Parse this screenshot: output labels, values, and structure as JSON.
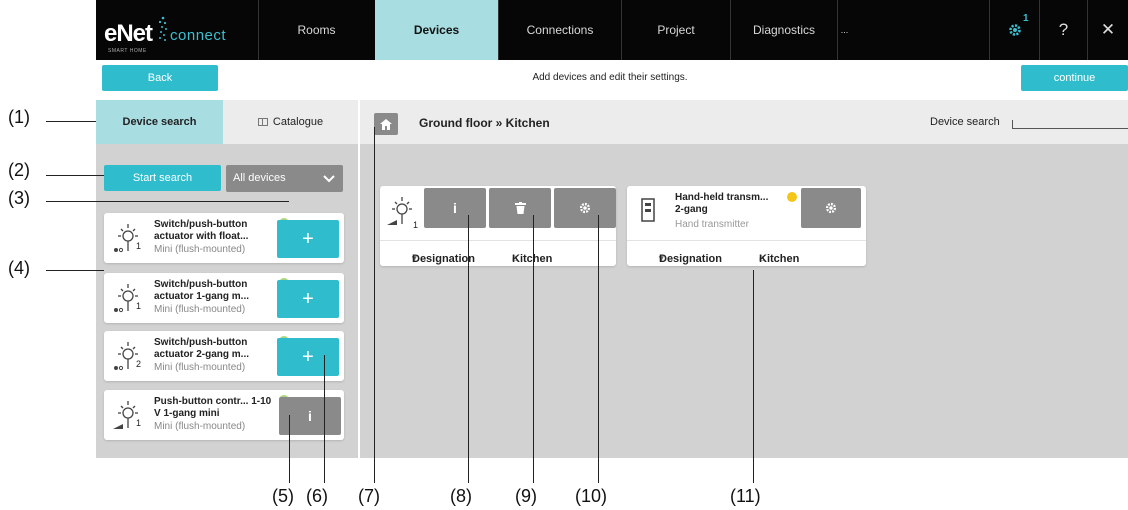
{
  "app": {
    "brand": "eNet",
    "brand_sub": "SMART HOME",
    "product": "connect"
  },
  "nav": {
    "tabs": [
      "Rooms",
      "Devices",
      "Connections",
      "Project",
      "Diagnostics"
    ],
    "active": "Devices",
    "overflow": "...",
    "settings_badge": "1",
    "help": "?",
    "close": "✕"
  },
  "subbar": {
    "back_label": "Back",
    "instruction": "Add devices and edit their settings.",
    "continue_label": "continue"
  },
  "left": {
    "tab_device_search": "Device search",
    "tab_catalogue": "Catalogue",
    "start_search": "Start search",
    "filter_value": "All devices",
    "devices": [
      {
        "name": "Switch/push-button actuator with float...",
        "type": "Mini (flush-mounted)",
        "channel": "1",
        "action": "+"
      },
      {
        "name": "Switch/push-button actuator 1-gang m...",
        "type": "Mini (flush-mounted)",
        "channel": "1",
        "action": "+"
      },
      {
        "name": "Switch/push-button actuator 2-gang m...",
        "type": "Mini (flush-mounted)",
        "channel": "2",
        "action": "+"
      },
      {
        "name": "Push-button contr... 1-10 V 1-gang mini",
        "type": "Mini (flush-mounted)",
        "channel": "1",
        "action": "i"
      }
    ]
  },
  "right": {
    "breadcrumb": "Ground floor » Kitchen",
    "search_label": "Device search",
    "cards": [
      {
        "channel": "1",
        "designation": "Designation",
        "room": "Kitchen"
      },
      {
        "title": "Hand-held transm...",
        "title2": "2-gang",
        "subtitle": "Hand transmitter",
        "designation": "Designation",
        "room": "Kitchen"
      }
    ]
  },
  "callouts": [
    "(1)",
    "(2)",
    "(3)",
    "(4)",
    "(5)",
    "(6)",
    "(7)",
    "(8)",
    "(9)",
    "(10)",
    "(11)"
  ],
  "colors": {
    "accent": "#2fbccd",
    "active_tab": "#a8dde2",
    "status_green": "#a9d77a",
    "status_yellow": "#f5c518"
  }
}
